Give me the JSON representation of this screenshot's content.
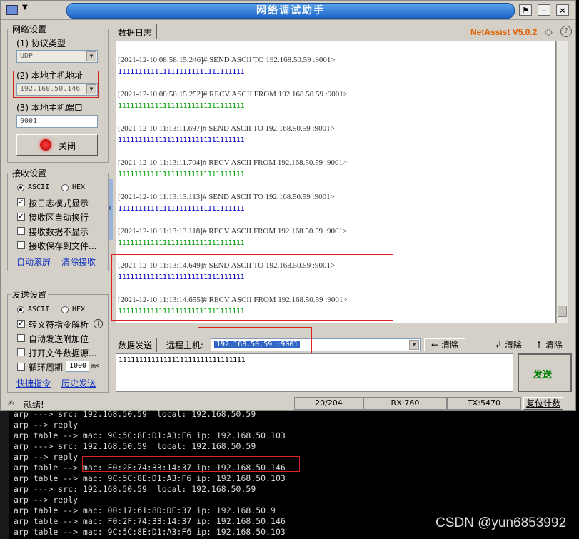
{
  "window": {
    "title": "网络调试助手",
    "brand": "NetAssist V5.0.2",
    "sys_menu_icon": "app-menu-icon"
  },
  "network": {
    "group_label": "网络设置",
    "protocol_label": "(1) 协议类型",
    "protocol_value": "UDP",
    "host_label": "(2) 本地主机地址",
    "host_value": "192.168.50.146",
    "port_label": "(3) 本地主机端口",
    "port_value": "9001",
    "close_button": "关闭"
  },
  "receive": {
    "group_label": "接收设置",
    "ascii": "ASCII",
    "hex": "HEX",
    "opt_log_mode": "按日志模式显示",
    "opt_auto_wrap": "接收区自动换行",
    "opt_no_show": "接收数据不显示",
    "opt_save_file": "接收保存到文件...",
    "auto_scroll": "自动滚屏",
    "clear_receive": "清除接收"
  },
  "send": {
    "group_label": "发送设置",
    "ascii": "ASCII",
    "hex": "HEX",
    "opt_escape": "转义符指令解析",
    "opt_append": "自动发送附加位",
    "opt_open_file": "打开文件数据源...",
    "opt_cycle": "循环周期",
    "cycle_value": "1000",
    "cycle_unit": "ms",
    "shortcut": "快捷指令",
    "history": "历史发送"
  },
  "log": {
    "tab_label": "数据日志",
    "entries": [
      {
        "header": "[2021-12-10 08:58:15.246]# SEND ASCII TO 192.168.50.59 :9001>",
        "data": "1111111111111111111111111111111",
        "kind": "send"
      },
      {
        "header": "[2021-12-10 08:58:15.252]# RECV ASCII FROM 192.168.50.59 :9001>",
        "data": "1111111111111111111111111111111",
        "kind": "recv"
      },
      {
        "header": "[2021-12-10 11:13:11.697]# SEND ASCII TO 192.168.50.59 :9001>",
        "data": "1111111111111111111111111111111",
        "kind": "send"
      },
      {
        "header": "[2021-12-10 11:13:11.704]# RECV ASCII FROM 192.168.50.59 :9001>",
        "data": "1111111111111111111111111111111",
        "kind": "recv"
      },
      {
        "header": "[2021-12-10 11:13:13.113]# SEND ASCII TO 192.168.50.59 :9001>",
        "data": "1111111111111111111111111111111",
        "kind": "send"
      },
      {
        "header": "[2021-12-10 11:13:13.118]# RECV ASCII FROM 192.168.50.59 :9001>",
        "data": "1111111111111111111111111111111",
        "kind": "recv"
      },
      {
        "header": "[2021-12-10 11:13:14.649]# SEND ASCII TO 192.168.50.59 :9001>",
        "data": "1111111111111111111111111111111",
        "kind": "send"
      },
      {
        "header": "[2021-12-10 11:13:14.655]# RECV ASCII FROM 192.168.50.59 :9001>",
        "data": "1111111111111111111111111111111",
        "kind": "recv"
      }
    ]
  },
  "sendbar": {
    "tab_label": "数据发送",
    "remote_label": "远程主机:",
    "remote_value": "192.168.50.59 :9001",
    "clear_remote": "清除",
    "clear1": "清除",
    "clear2": "清除",
    "send_text": "1111111111111111111111111111111",
    "send_button": "发送"
  },
  "status": {
    "ready": "就绪!",
    "count": "20/204",
    "rx": "RX:760",
    "tx": "TX:5470",
    "reset": "复位计数"
  },
  "terminal": {
    "lines": [
      "arp ---> src: 192.168.50.59  local: 192.168.50.59",
      "arp --> reply",
      "arp table --> mac: 9C:5C:8E:D1:A3:F6 ip: 192.168.50.103",
      "arp ---> src: 192.168.50.59  local: 192.168.50.59",
      "arp --> reply",
      "arp table --> mac: F0:2F:74:33:14:37 ip: 192.168.50.146",
      "arp table --> mac: 9C:5C:8E:D1:A3:F6 ip: 192.168.50.103",
      "arp ---> src: 192.168.50.59  local: 192.168.50.59",
      "arp --> reply",
      "arp table --> mac: 00:17:61:8D:DE:37 ip: 192.168.50.9",
      "arp table --> mac: F0:2F:74:33:14:37 ip: 192.168.50.146",
      "arp table --> mac: 9C:5C:8E:D1:A3:F6 ip: 192.168.50.103"
    ]
  },
  "watermark": "CSDN @yun6853992",
  "colors": {
    "title_blue": "#1e66c8",
    "brand_orange": "#e06000",
    "send_green": "#008000",
    "log_send": "#0000c8",
    "log_recv": "#00a000",
    "highlight_red": "#dd2222"
  }
}
